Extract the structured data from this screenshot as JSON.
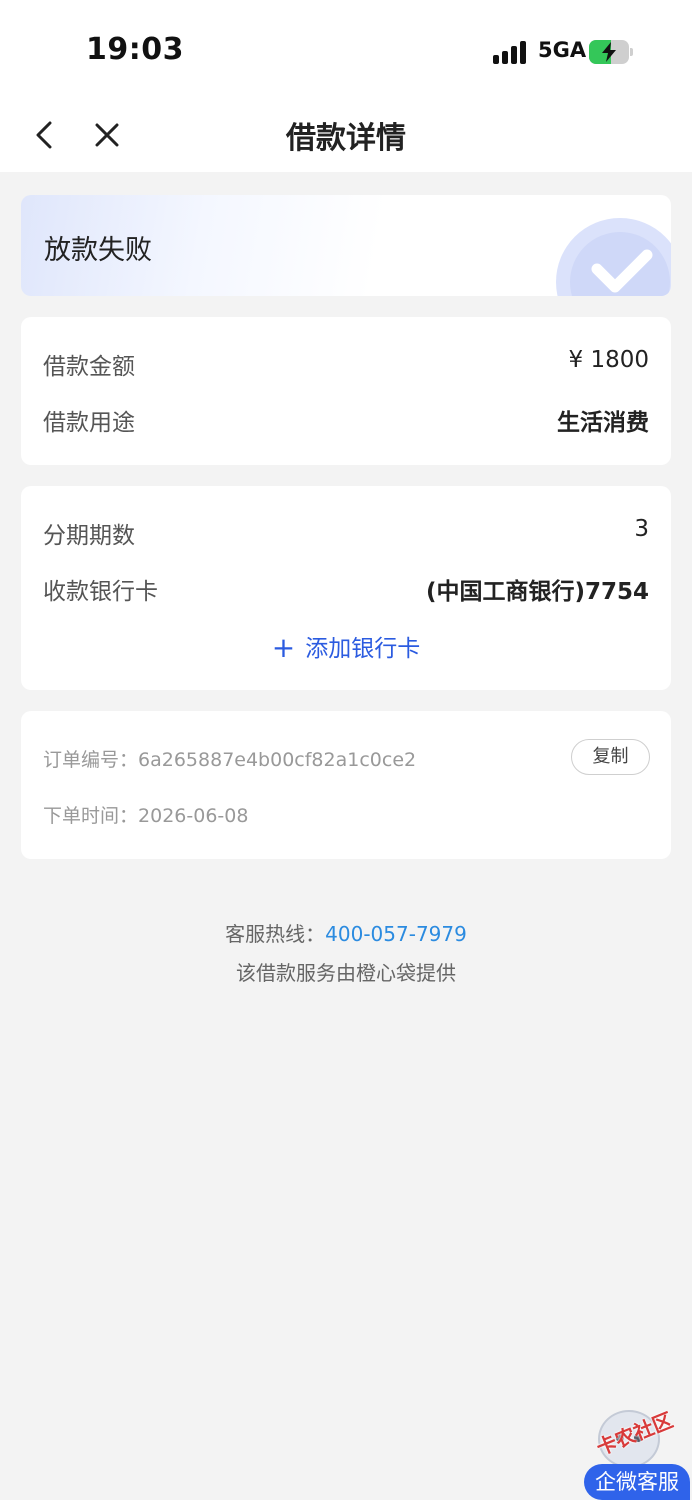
{
  "status_bar": {
    "time": "19:03",
    "network": "5GA",
    "battery_level": 0.55
  },
  "nav": {
    "title": "借款详情"
  },
  "status": {
    "title": "放款失败"
  },
  "loan": {
    "amount_label": "借款金额",
    "amount_value": "¥ 1800",
    "purpose_label": "借款用途",
    "purpose_value": "生活消费"
  },
  "installment": {
    "periods_label": "分期期数",
    "periods_value": "3",
    "bank_label": "收款银行卡",
    "bank_value": "(中国工商银行)7754",
    "add_card_label": "添加银行卡"
  },
  "order": {
    "number_label": "订单编号：",
    "number_value": "6a265887e4b00cf82a1c0ce2",
    "copy_label": "复制",
    "time_label": "下单时间：",
    "time_value": "2026-06-08"
  },
  "footer": {
    "hotline_label": "客服热线：",
    "hotline_number": "400-057-7979",
    "provider_text": "该借款服务由橙心袋提供"
  },
  "widget": {
    "watermark": "卡农社区",
    "cs_label": "企微客服"
  },
  "colors": {
    "accent": "#2b5be0",
    "link": "#2b8be0",
    "background": "#f3f3f3"
  }
}
